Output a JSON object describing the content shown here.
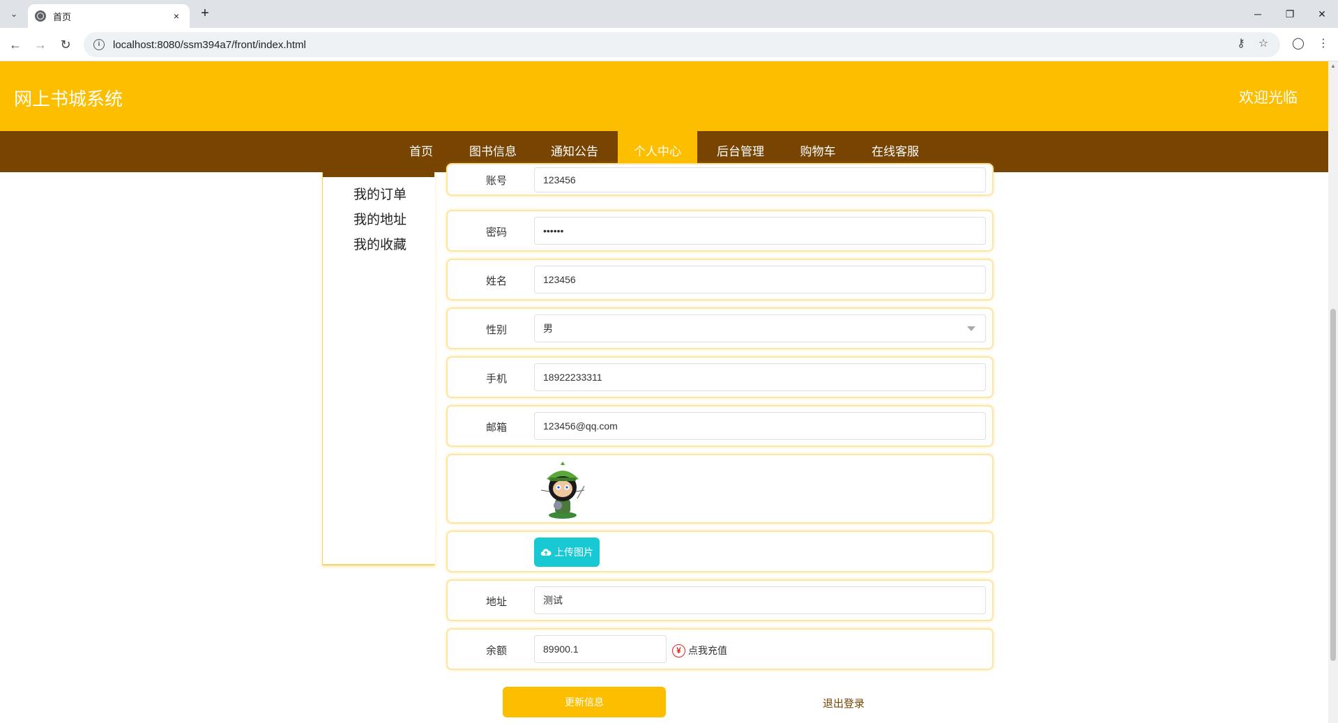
{
  "browser": {
    "tab_title": "首页",
    "tab_close": "×",
    "new_tab": "+",
    "url": "localhost:8080/ssm394a7/front/index.html",
    "controls": {
      "minimize": "─",
      "restore": "❐",
      "close": "✕"
    },
    "nav": {
      "back": "←",
      "forward": "→",
      "reload": "↻"
    },
    "icons": {
      "tab_list": "⌄",
      "info": "i",
      "key": "⚷",
      "star": "☆",
      "profile": "◯",
      "menu": "⋮"
    }
  },
  "site": {
    "title": "网上书城系统",
    "welcome": "欢迎光临",
    "colors": {
      "primary": "#fdbe00",
      "nav": "#774402",
      "upload": "#18c8d3"
    }
  },
  "nav": {
    "items": [
      {
        "label": "首页"
      },
      {
        "label": "图书信息"
      },
      {
        "label": "通知公告"
      },
      {
        "label": "个人中心",
        "active": true
      },
      {
        "label": "后台管理"
      },
      {
        "label": "购物车"
      },
      {
        "label": "在线客服"
      }
    ]
  },
  "side_menu": {
    "items": [
      {
        "label": "我的订单"
      },
      {
        "label": "我的地址"
      },
      {
        "label": "我的收藏"
      }
    ]
  },
  "form": {
    "account": {
      "label": "账号",
      "value": "123456"
    },
    "password": {
      "label": "密码",
      "value": "••••••"
    },
    "name": {
      "label": "姓名",
      "value": "123456"
    },
    "gender": {
      "label": "性别",
      "value": "男"
    },
    "phone": {
      "label": "手机",
      "value": "18922233311"
    },
    "email": {
      "label": "邮箱",
      "value": "123456@qq.com"
    },
    "upload_label": "上传图片",
    "address": {
      "label": "地址",
      "value": "测试"
    },
    "balance": {
      "label": "余额",
      "value": "89900.1"
    },
    "recharge_label": "点我充值",
    "recharge_icon": "¥",
    "update_button": "更新信息",
    "logout_button": "退出登录"
  }
}
